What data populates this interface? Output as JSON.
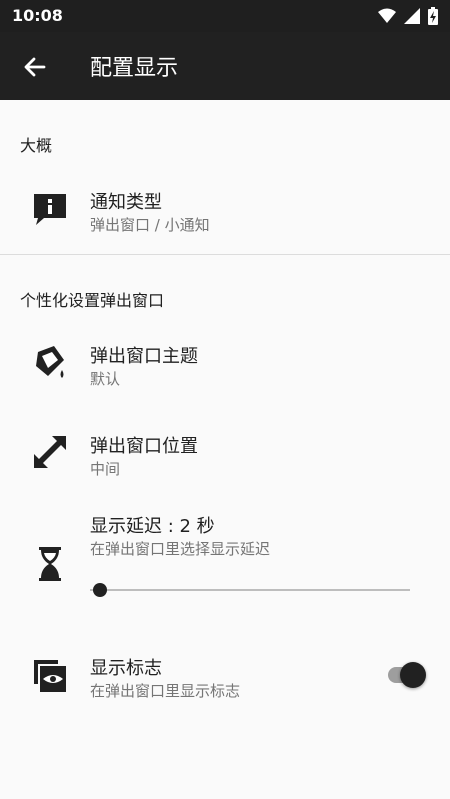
{
  "status_bar": {
    "time": "10:08",
    "icons": [
      "wifi-icon",
      "signal-icon",
      "battery-charging-icon"
    ]
  },
  "app_bar": {
    "title": "配置显示",
    "back_icon": "arrow-left-icon"
  },
  "sections": {
    "general": {
      "title": "大概"
    },
    "personalize": {
      "title": "个性化设置弹出窗口"
    }
  },
  "items": {
    "notification_type": {
      "title": "通知类型",
      "subtitle": "弹出窗口 / 小通知",
      "icon": "message-info-icon"
    },
    "popup_theme": {
      "title": "弹出窗口主题",
      "subtitle": "默认",
      "icon": "paint-bucket-icon"
    },
    "popup_position": {
      "title": "弹出窗口位置",
      "subtitle": "中间",
      "icon": "resize-arrows-icon"
    },
    "display_delay": {
      "title": "显示延迟 : 2 秒",
      "subtitle": "在弹出窗口里选择显示延迟",
      "icon": "hourglass-icon",
      "slider_value": 0
    },
    "show_logo": {
      "title": "显示标志",
      "subtitle": "在弹出窗口里显示标志",
      "icon": "eye-window-icon",
      "toggle_on": true
    }
  },
  "colors": {
    "app_bar": "#212121",
    "background": "#fafafa",
    "secondary_text": "#757575"
  }
}
